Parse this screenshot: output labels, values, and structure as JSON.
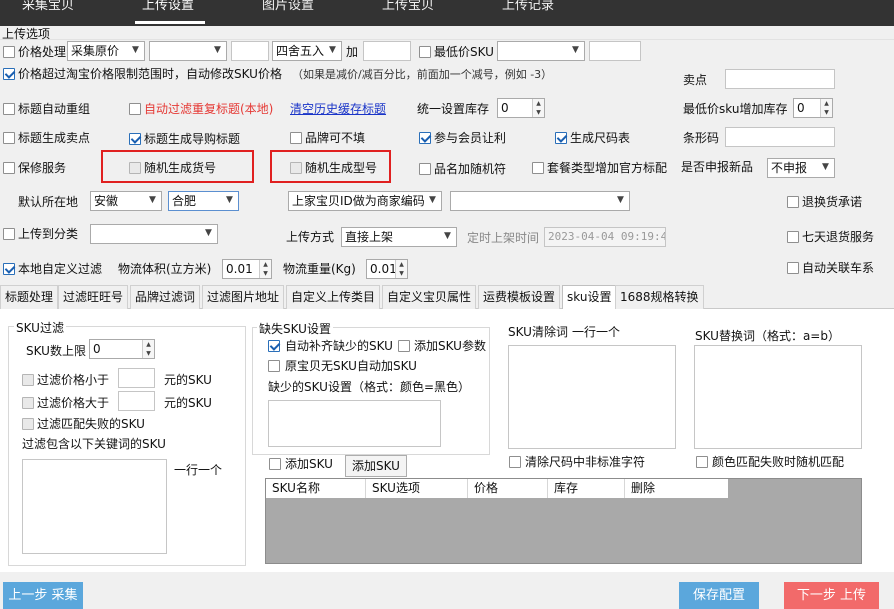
{
  "nav": {
    "items": [
      "采集宝贝",
      "上传设置",
      "图片设置",
      "上传宝贝",
      "上传记录"
    ],
    "active_index": 1
  },
  "section_title": "上传选项",
  "row1": {
    "price_process": {
      "label": "价格处理",
      "checked": false
    },
    "price_source": "采集原价",
    "select2": "",
    "input3": "",
    "rounding": "四舍五入",
    "add_label": "加",
    "add_value": "",
    "min_sku_price": {
      "label": "最低价SKU",
      "checked": false
    },
    "min_sku_select": "",
    "min_sku_value": ""
  },
  "row2": {
    "auto_modify": {
      "label": "价格超过淘宝价格限制范围时，自动修改SKU价格",
      "checked": true
    },
    "hint": "（如果是减价/减百分比，前面加一个减号，例如 -3）",
    "sell_point_label": "卖点",
    "sell_point_value": ""
  },
  "row3": {
    "title_auto_regroup": {
      "label": "标题自动重组",
      "checked": false
    },
    "auto_filter_dup": {
      "label": "自动过滤重复标题(本地)",
      "checked": false
    },
    "clear_cache_link": "清空历史缓存标题",
    "unified_stock_label": "统一设置库存",
    "unified_stock_value": "0",
    "min_sku_stock_label": "最低价sku增加库存",
    "min_sku_stock_value": "0"
  },
  "row4": {
    "title_gen_sellpoint": {
      "label": "标题生成卖点",
      "checked": false
    },
    "title_gen_shopping": {
      "label": "标题生成导购标题",
      "checked": true
    },
    "brand_optional": {
      "label": "品牌可不填",
      "checked": false
    },
    "member_discount": {
      "label": "参与会员让利",
      "checked": true
    },
    "size_table": {
      "label": "生成尺码表",
      "checked": true
    },
    "barcode_label": "条形码",
    "barcode_value": ""
  },
  "row5": {
    "warranty": {
      "label": "保修服务",
      "checked": false
    },
    "random_item_no": {
      "label": "随机生成货号",
      "checked": false
    },
    "random_model_no": {
      "label": "随机生成型号",
      "checked": false
    },
    "random_name": {
      "label": "品名加随机符",
      "checked": false
    },
    "package_official": {
      "label": "套餐类型增加官方标配",
      "checked": false
    },
    "new_product_label": "是否申报新品",
    "new_product_value": "不申报"
  },
  "row6": {
    "location_label": "默认所在地",
    "province": "安徽",
    "city": "合肥",
    "merchant_code": "上家宝贝ID做为商家编码",
    "merchant_code2": "",
    "return_freight": {
      "label": "退换货承诺",
      "checked": false
    }
  },
  "row7": {
    "upload_category": {
      "label": "上传到分类",
      "checked": false
    },
    "category_value": "",
    "upload_method_label": "上传方式",
    "upload_method_value": "直接上架",
    "scheduled_label": "定时上架时间",
    "scheduled_value": "2023-04-04 09:19:40",
    "seven_days": {
      "label": "七天退货服务",
      "checked": false
    }
  },
  "row8": {
    "local_filter": {
      "label": "本地自定义过滤",
      "checked": true
    },
    "volume_label": "物流体积(立方米)",
    "volume_value": "0.01",
    "weight_label": "物流重量(Kg)",
    "weight_value": "0.01",
    "auto_link_car": {
      "label": "自动关联车系",
      "checked": false
    }
  },
  "tabs": [
    "标题处理",
    "过滤旺旺号",
    "品牌过滤词",
    "过滤图片地址",
    "自定义上传类目",
    "自定义宝贝属性",
    "运费模板设置",
    "sku设置",
    "1688规格转换"
  ],
  "active_tab": 7,
  "sku_filter": {
    "title": "SKU过滤",
    "max_label": "SKU数上限",
    "max_value": "0",
    "price_less": {
      "label": "过滤价格小于",
      "checked": false
    },
    "price_less_value": "",
    "price_less_unit": "元的SKU",
    "price_greater": {
      "label": "过滤价格大于",
      "checked": false
    },
    "price_greater_value": "",
    "price_greater_unit": "元的SKU",
    "match_fail": {
      "label": "过滤匹配失败的SKU",
      "checked": false
    },
    "keyword_label": "过滤包含以下关键词的SKU",
    "one_per_line": "一行一个"
  },
  "missing_sku": {
    "title": "缺失SKU设置",
    "auto_fill": {
      "label": "自动补齐缺少的SKU",
      "checked": true
    },
    "add_params": {
      "label": "添加SKU参数",
      "checked": false
    },
    "auto_add": {
      "label": "原宝贝无SKU自动加SKU",
      "checked": false
    },
    "format_label": "缺少的SKU设置（格式：颜色=黑色）"
  },
  "sku_clear": {
    "label": "SKU清除词",
    "one_per_line": "一行一个",
    "clear_nonstandard": {
      "label": "清除尺码中非标准字符",
      "checked": false
    }
  },
  "sku_replace": {
    "label": "SKU替换词（格式：a=b）",
    "color_random": {
      "label": "颜色匹配失败时随机匹配",
      "checked": false
    }
  },
  "add_sku": {
    "check": {
      "label": "添加SKU",
      "checked": false
    },
    "button": "添加SKU"
  },
  "sku_table": {
    "columns": [
      "SKU名称",
      "SKU选项",
      "价格",
      "库存",
      "删除"
    ]
  },
  "buttons": {
    "prev": "上一步 采集",
    "save": "保存配置",
    "next": "下一步 上传"
  },
  "colors": {
    "nav_bg": "#333333",
    "prev_btn": "#5ba7dc",
    "save_btn": "#5ba7dc",
    "next_btn": "#f26a6a",
    "highlight_box": "#e02020"
  }
}
